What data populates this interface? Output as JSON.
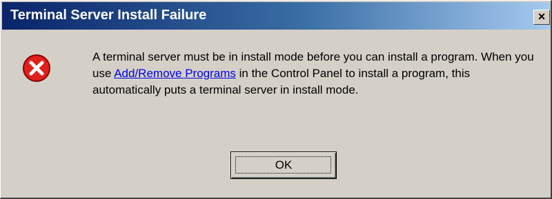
{
  "window": {
    "title": "Terminal Server Install Failure",
    "close_label": "×",
    "colors": {
      "title_bar_start": "#0a246a",
      "title_bar_end": "#a6caf0",
      "dialog_bg": "#d4d0c8",
      "link": "#0000ee"
    }
  },
  "icon": {
    "name": "error-icon",
    "color": "#e0201a"
  },
  "message": {
    "part1": "A terminal server must be in install mode before you can install a program. When you use ",
    "link_text": "Add/Remove Programs",
    "part2": " in the Control Panel to install a program, this automatically puts a terminal server in install mode."
  },
  "buttons": {
    "ok_label": "OK"
  }
}
